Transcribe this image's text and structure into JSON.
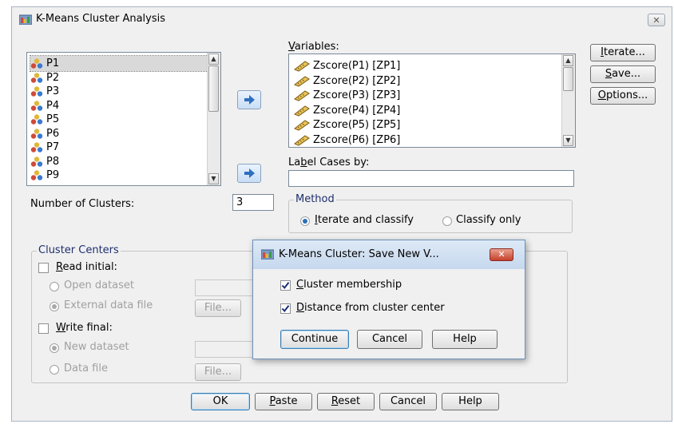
{
  "window": {
    "title": "K-Means Cluster Analysis",
    "close_glyph": "✕"
  },
  "source_list": {
    "items": [
      "P1",
      "P2",
      "P3",
      "P4",
      "P5",
      "P6",
      "P7",
      "P8",
      "P9"
    ],
    "selected": "P1"
  },
  "variables": {
    "label": "Variables:",
    "items": [
      "Zscore(P1) [ZP1]",
      "Zscore(P2) [ZP2]",
      "Zscore(P3) [ZP3]",
      "Zscore(P4) [ZP4]",
      "Zscore(P5) [ZP5]",
      "Zscore(P6) [ZP6]"
    ]
  },
  "label_cases": {
    "label": "Label Cases by:",
    "value": ""
  },
  "side_buttons": {
    "iterate": "Iterate...",
    "save": "Save...",
    "options": "Options..."
  },
  "num_clusters": {
    "label": "Number of Clusters:",
    "value": "3"
  },
  "method": {
    "label": "Method",
    "iterate_classify": "Iterate and classify",
    "classify_only": "Classify only",
    "selected": "Iterate and classify"
  },
  "cluster_centers": {
    "label": "Cluster Centers",
    "read_initial": "Read initial:",
    "open_dataset": "Open dataset",
    "external_data_file": "External data file",
    "file_button": "File...",
    "write_final": "Write final:",
    "new_dataset": "New dataset",
    "data_file": "Data file",
    "file_button2": "File..."
  },
  "bottom_buttons": {
    "ok": "OK",
    "paste": "Paste",
    "reset": "Reset",
    "cancel": "Cancel",
    "help": "Help"
  },
  "save_dialog": {
    "title": "K-Means Cluster: Save New V...",
    "cluster_membership": "Cluster membership",
    "distance": "Distance from cluster center",
    "cluster_membership_checked": true,
    "distance_checked": true,
    "continue": "Continue",
    "cancel": "Cancel",
    "help": "Help"
  },
  "colors": {
    "accent": "#2b6fb8",
    "group_label": "#1f2f6e",
    "selection": "#d9d9d9"
  }
}
